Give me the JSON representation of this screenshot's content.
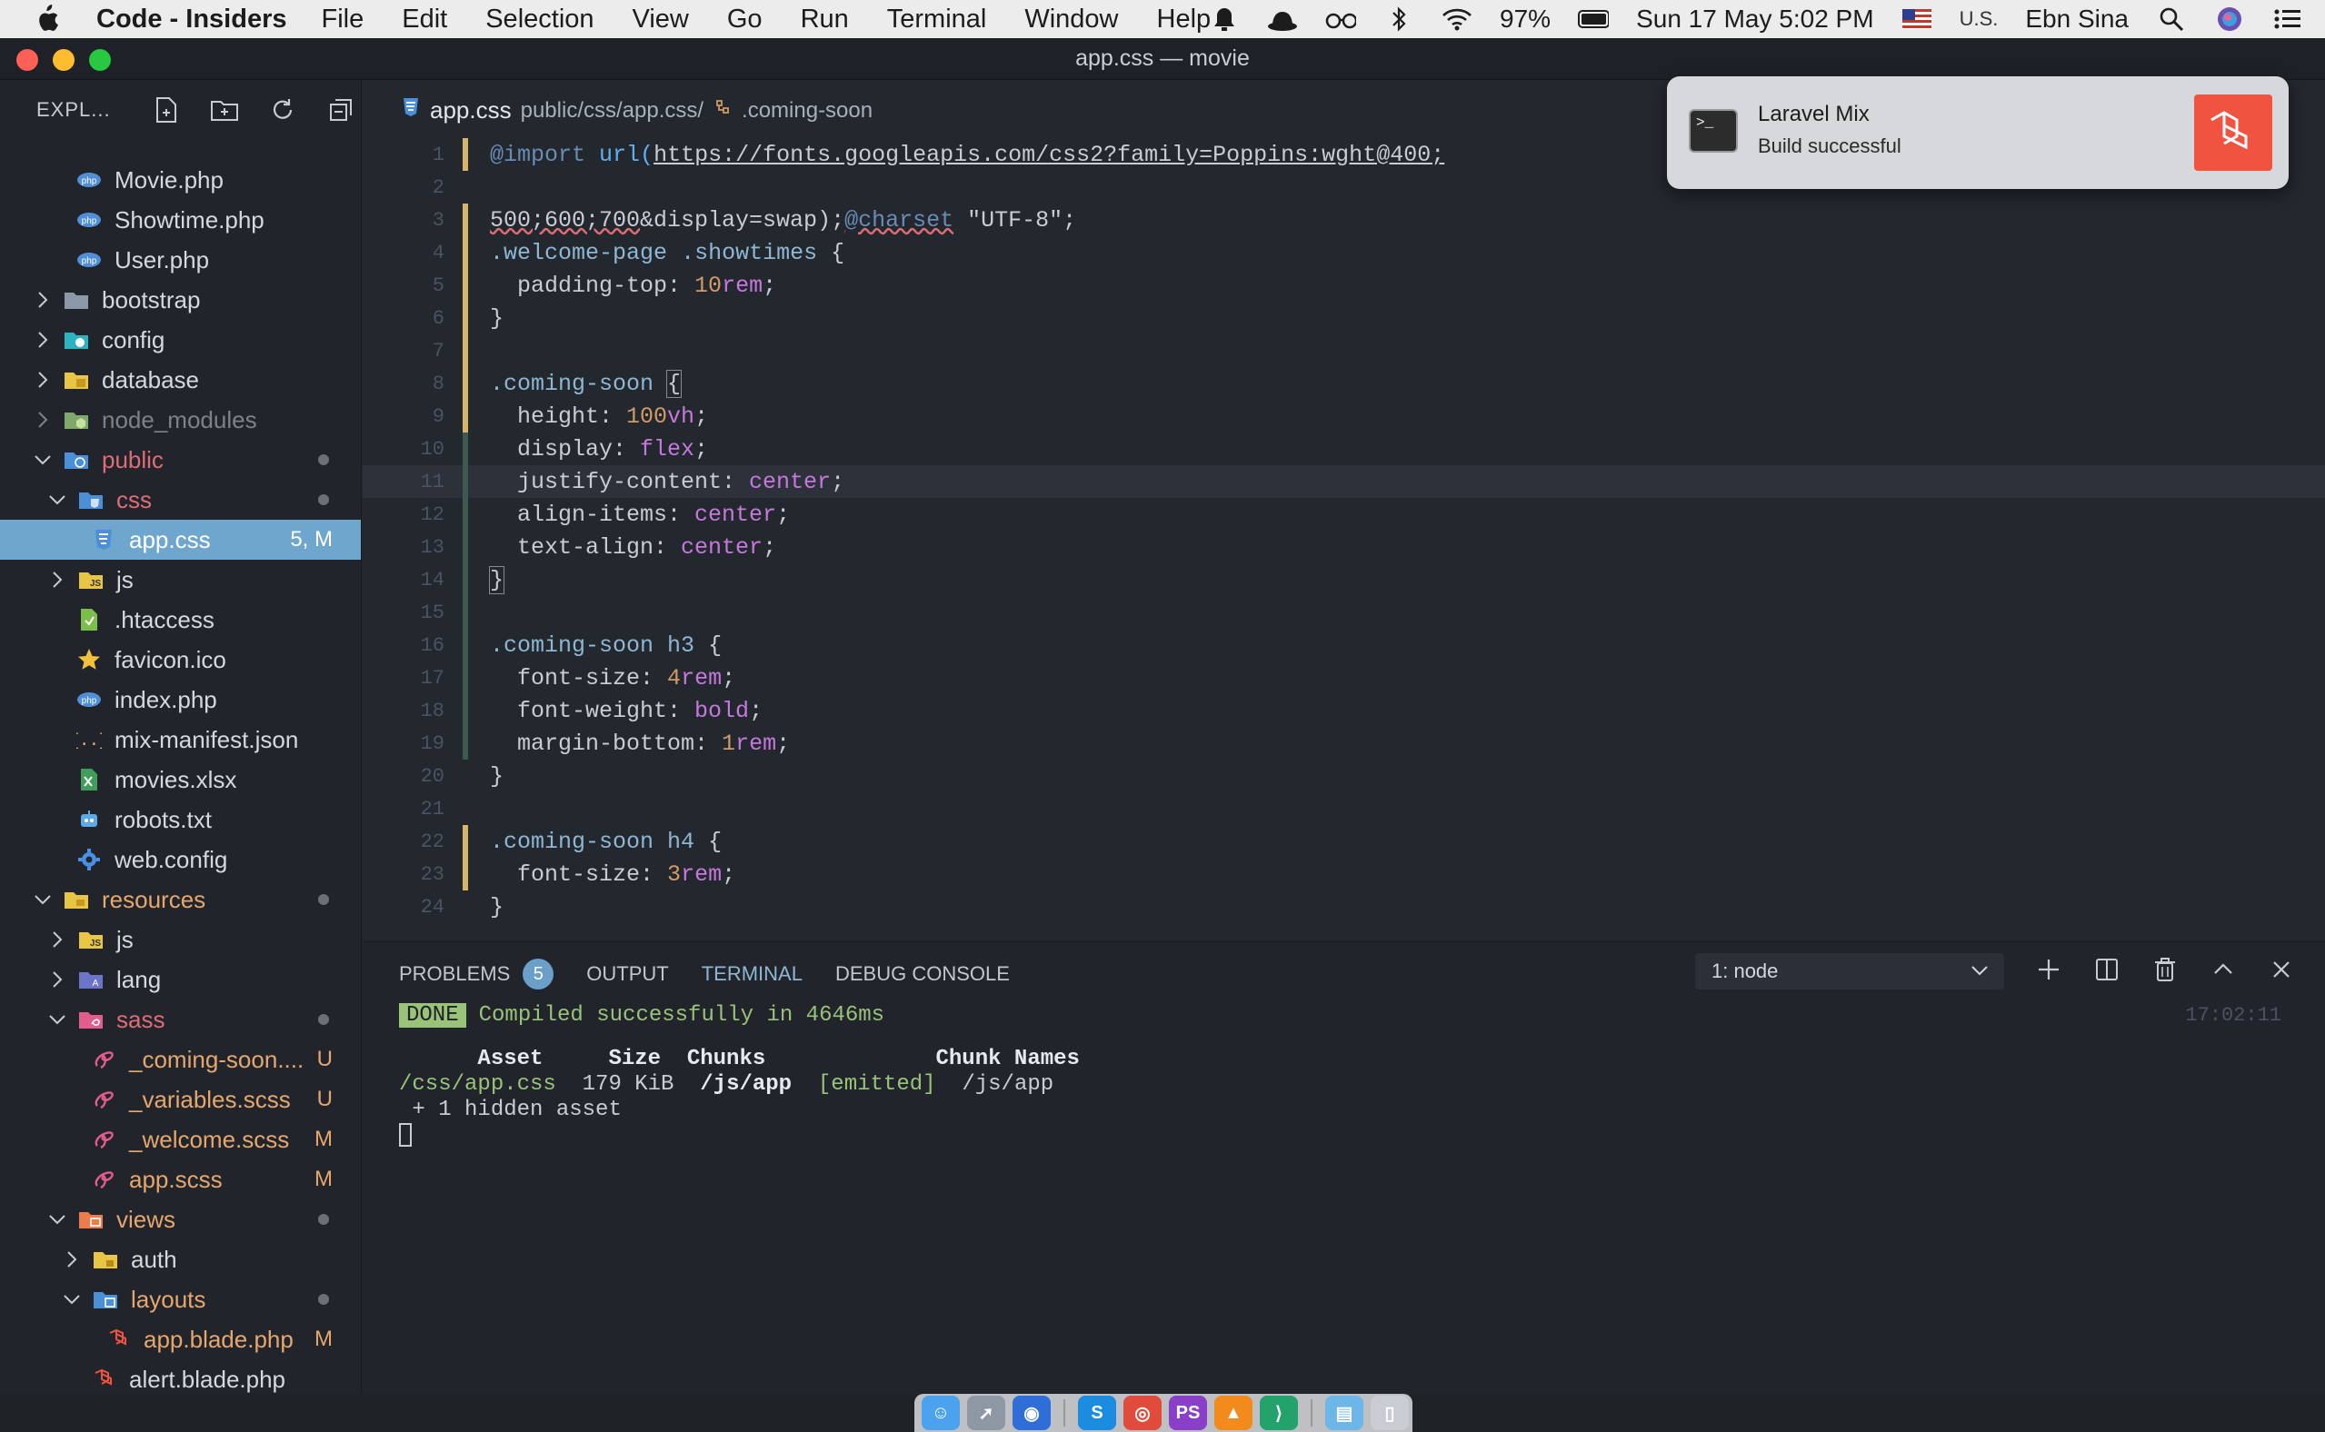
{
  "menubar": {
    "app_name": "Code - Insiders",
    "menus": [
      "File",
      "Edit",
      "Selection",
      "View",
      "Go",
      "Run",
      "Terminal",
      "Window",
      "Help"
    ],
    "battery": "97%",
    "datetime": "Sun 17 May  5:02 PM",
    "input_source": "U.S.",
    "user": "Ebn Sina"
  },
  "window": {
    "title": "app.css — movie"
  },
  "sidebar": {
    "title": "EXPL...",
    "items": [
      {
        "name": "Movie.php",
        "status": ""
      },
      {
        "name": "Showtime.php",
        "status": ""
      },
      {
        "name": "User.php",
        "status": ""
      },
      {
        "name": "bootstrap",
        "status": ""
      },
      {
        "name": "config",
        "status": ""
      },
      {
        "name": "database",
        "status": ""
      },
      {
        "name": "node_modules",
        "status": ""
      },
      {
        "name": "public",
        "status": ""
      },
      {
        "name": "css",
        "status": ""
      },
      {
        "name": "app.css",
        "status": "5, M"
      },
      {
        "name": "js",
        "status": ""
      },
      {
        "name": ".htaccess",
        "status": ""
      },
      {
        "name": "favicon.ico",
        "status": ""
      },
      {
        "name": "index.php",
        "status": ""
      },
      {
        "name": "mix-manifest.json",
        "status": ""
      },
      {
        "name": "movies.xlsx",
        "status": ""
      },
      {
        "name": "robots.txt",
        "status": ""
      },
      {
        "name": "web.config",
        "status": ""
      },
      {
        "name": "resources",
        "status": ""
      },
      {
        "name": "js",
        "status": ""
      },
      {
        "name": "lang",
        "status": ""
      },
      {
        "name": "sass",
        "status": ""
      },
      {
        "name": "_coming-soon....",
        "status": "U"
      },
      {
        "name": "_variables.scss",
        "status": "U"
      },
      {
        "name": "_welcome.scss",
        "status": "M"
      },
      {
        "name": "app.scss",
        "status": "M"
      },
      {
        "name": "views",
        "status": ""
      },
      {
        "name": "auth",
        "status": ""
      },
      {
        "name": "layouts",
        "status": ""
      },
      {
        "name": "app.blade.php",
        "status": "M"
      },
      {
        "name": "alert.blade.php",
        "status": ""
      }
    ]
  },
  "editor": {
    "breadcrumb": {
      "file": "app.css",
      "path": "public/css/app.css/",
      "symbol": ".coming-soon"
    },
    "line_numbers": [
      "1",
      "2",
      "3",
      "4",
      "5",
      "6",
      "7",
      "8",
      "9",
      "10",
      "11",
      "12",
      "13",
      "14",
      "15",
      "16",
      "17",
      "18",
      "19",
      "20",
      "21",
      "22",
      "23",
      "24"
    ]
  },
  "notification": {
    "title": "Laravel Mix",
    "body": "Build successful"
  },
  "panel": {
    "tabs": [
      "PROBLEMS",
      "OUTPUT",
      "TERMINAL",
      "DEBUG CONSOLE"
    ],
    "problems_count": "5",
    "terminal_select": "1: node",
    "terminal": {
      "done_label": "DONE",
      "compiled": "Compiled successfully in 4646ms",
      "timestamp": "17:02:11",
      "header": "      Asset     Size  Chunks             Chunk Names",
      "asset_name": "/css/app.css",
      "asset_rest": "  179 KiB  ",
      "asset_chunk": "/js/app",
      "asset_emitted": "  [emitted]",
      "asset_names": "  /js/app",
      "hidden": " + 1 hidden asset"
    }
  },
  "colors": {
    "accent": "#6fa6cd",
    "modified": "#e5a76e",
    "untracked": "#98c379",
    "notif_brand": "#f05340"
  }
}
